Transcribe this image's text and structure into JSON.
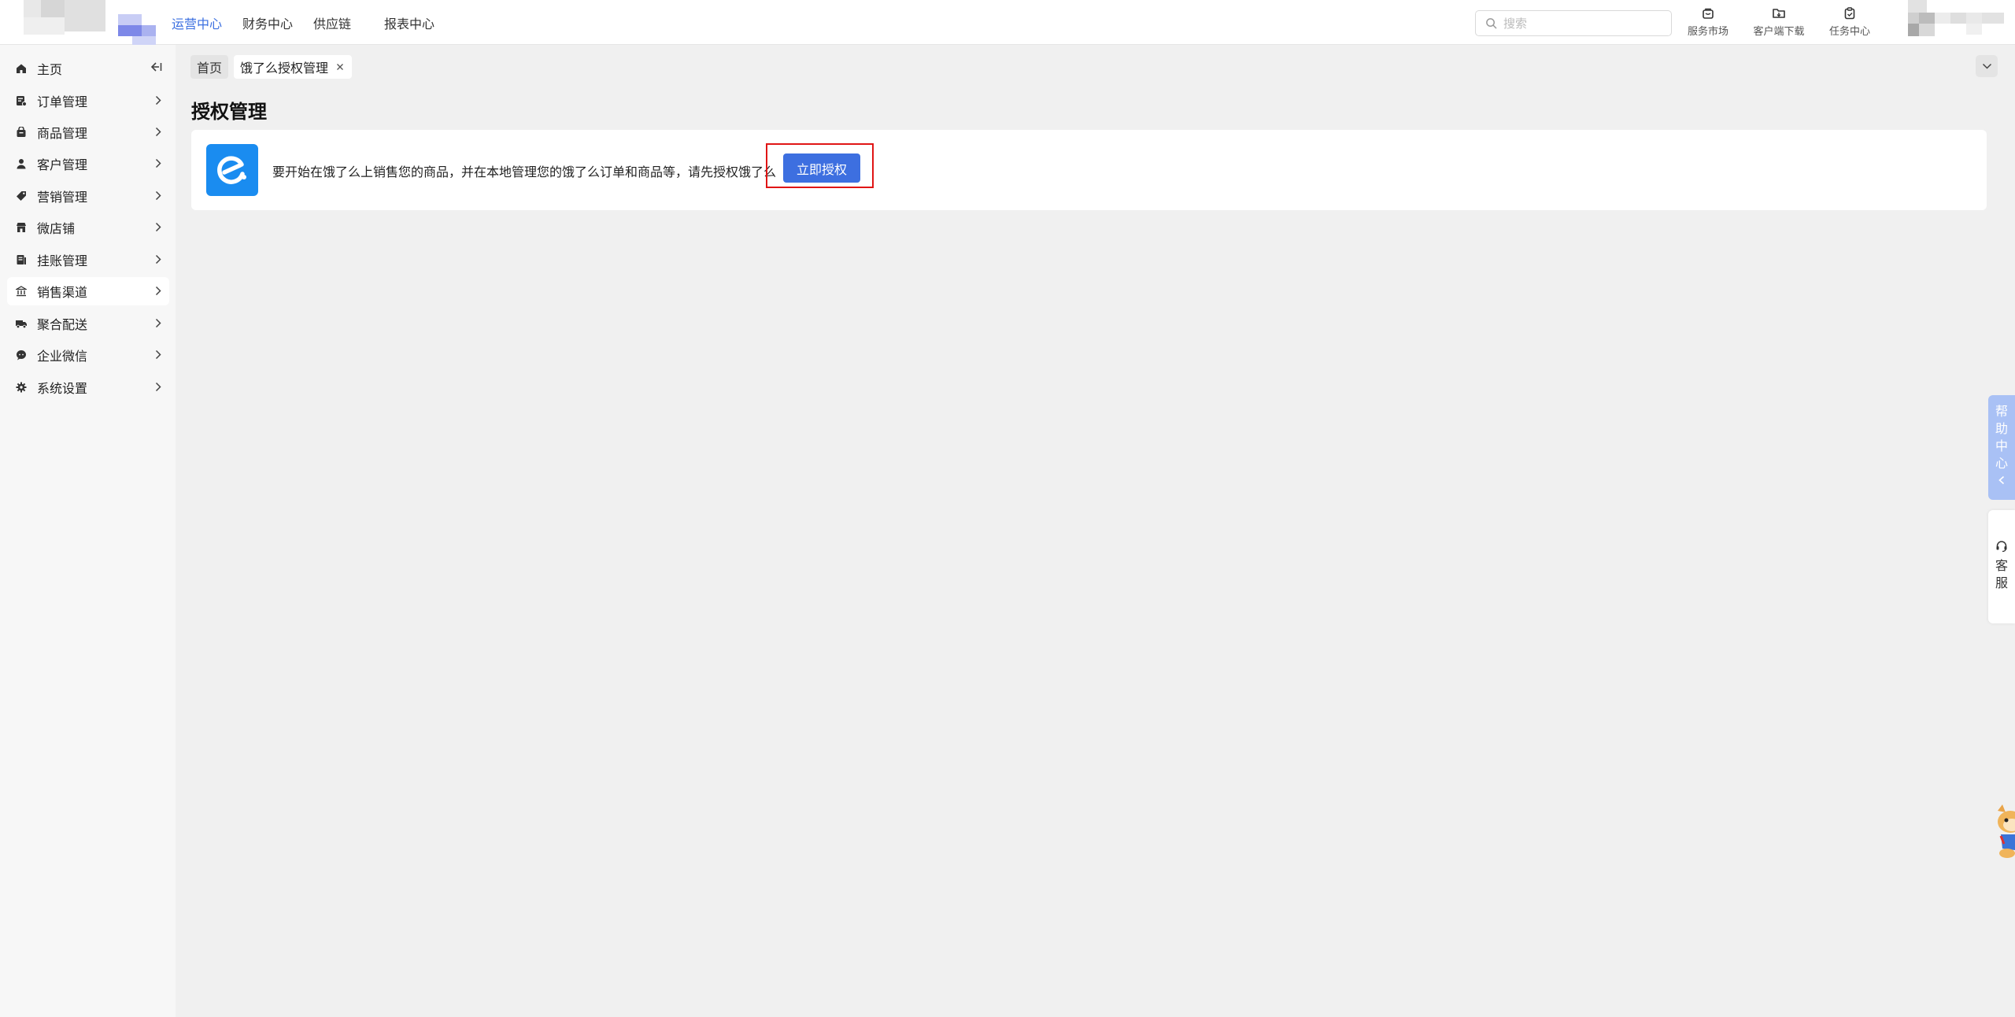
{
  "header": {
    "nav": [
      {
        "label": "运营中心",
        "active": true
      },
      {
        "label": "财务中心",
        "active": false
      },
      {
        "label": "供应链",
        "active": false
      },
      {
        "label": "报表中心",
        "active": false
      }
    ],
    "search_placeholder": "搜索",
    "actions": [
      {
        "label": "服务市场",
        "icon": "store-icon"
      },
      {
        "label": "客户端下载",
        "icon": "download-folder-icon"
      },
      {
        "label": "任务中心",
        "icon": "clipboard-icon"
      }
    ]
  },
  "sidebar": {
    "items": [
      {
        "label": "主页",
        "icon": "home-icon",
        "active": false,
        "has_children": false
      },
      {
        "label": "订单管理",
        "icon": "order-icon",
        "active": false,
        "has_children": true
      },
      {
        "label": "商品管理",
        "icon": "product-icon",
        "active": false,
        "has_children": true
      },
      {
        "label": "客户管理",
        "icon": "user-icon",
        "active": false,
        "has_children": true
      },
      {
        "label": "营销管理",
        "icon": "tag-icon",
        "active": false,
        "has_children": true
      },
      {
        "label": "微店铺",
        "icon": "shop-icon",
        "active": false,
        "has_children": true
      },
      {
        "label": "挂账管理",
        "icon": "ledger-icon",
        "active": false,
        "has_children": true
      },
      {
        "label": "销售渠道",
        "icon": "bank-icon",
        "active": true,
        "has_children": true
      },
      {
        "label": "聚合配送",
        "icon": "truck-icon",
        "active": false,
        "has_children": true
      },
      {
        "label": "企业微信",
        "icon": "wechat-icon",
        "active": false,
        "has_children": true
      },
      {
        "label": "系统设置",
        "icon": "gear-icon",
        "active": false,
        "has_children": true
      }
    ]
  },
  "tabs": {
    "home": "首页",
    "active": "饿了么授权管理"
  },
  "main": {
    "title": "授权管理",
    "card_text": "要开始在饿了么上销售您的商品，并在本地管理您的饿了么订单和商品等，请先授权饿了么",
    "auth_button": "立即授权"
  },
  "float": {
    "help_center": "帮助中心",
    "service": "客服"
  },
  "colors": {
    "accent": "#3d6fe0",
    "active_nav": "#3b6fe0",
    "eleme_blue": "#1a8cf0",
    "highlight_red": "#e01515",
    "help_bg": "#a9c1f5"
  }
}
